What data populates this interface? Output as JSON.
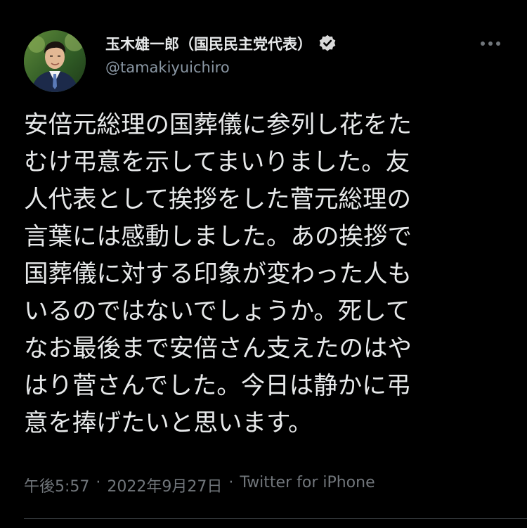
{
  "author": {
    "display_name": "玉木雄一郎（国民民主党代表）",
    "handle": "@tamakiyuichiro",
    "verified": true
  },
  "icons": {
    "avatar": "profile-photo",
    "verified": "verified-badge-icon",
    "more": "more-options-icon"
  },
  "tweet": {
    "lines": [
      "安倍元総理の国葬儀に参列し花をた",
      "むけ弔意を示してまいりました。友",
      "人代表として挨拶をした菅元総理の",
      "言葉には感動しました。あの挨拶で",
      "国葬儀に対する印象が変わった人も",
      "いるのではないでしょうか。死して",
      "なお最後まで安倍さん支えたのはや",
      "はり菅さんでした。今日は静かに弔",
      "意を捧げたいと思います。"
    ]
  },
  "meta": {
    "time": "午後5:57",
    "separator": "·",
    "date": "2022年9月27日",
    "source": "Twitter for iPhone"
  },
  "colors": {
    "background": "#000000",
    "text": "#e7e9ea",
    "secondary": "#8b98a5",
    "meta": "#71767b",
    "verified_badge": "#d9d9d9"
  }
}
